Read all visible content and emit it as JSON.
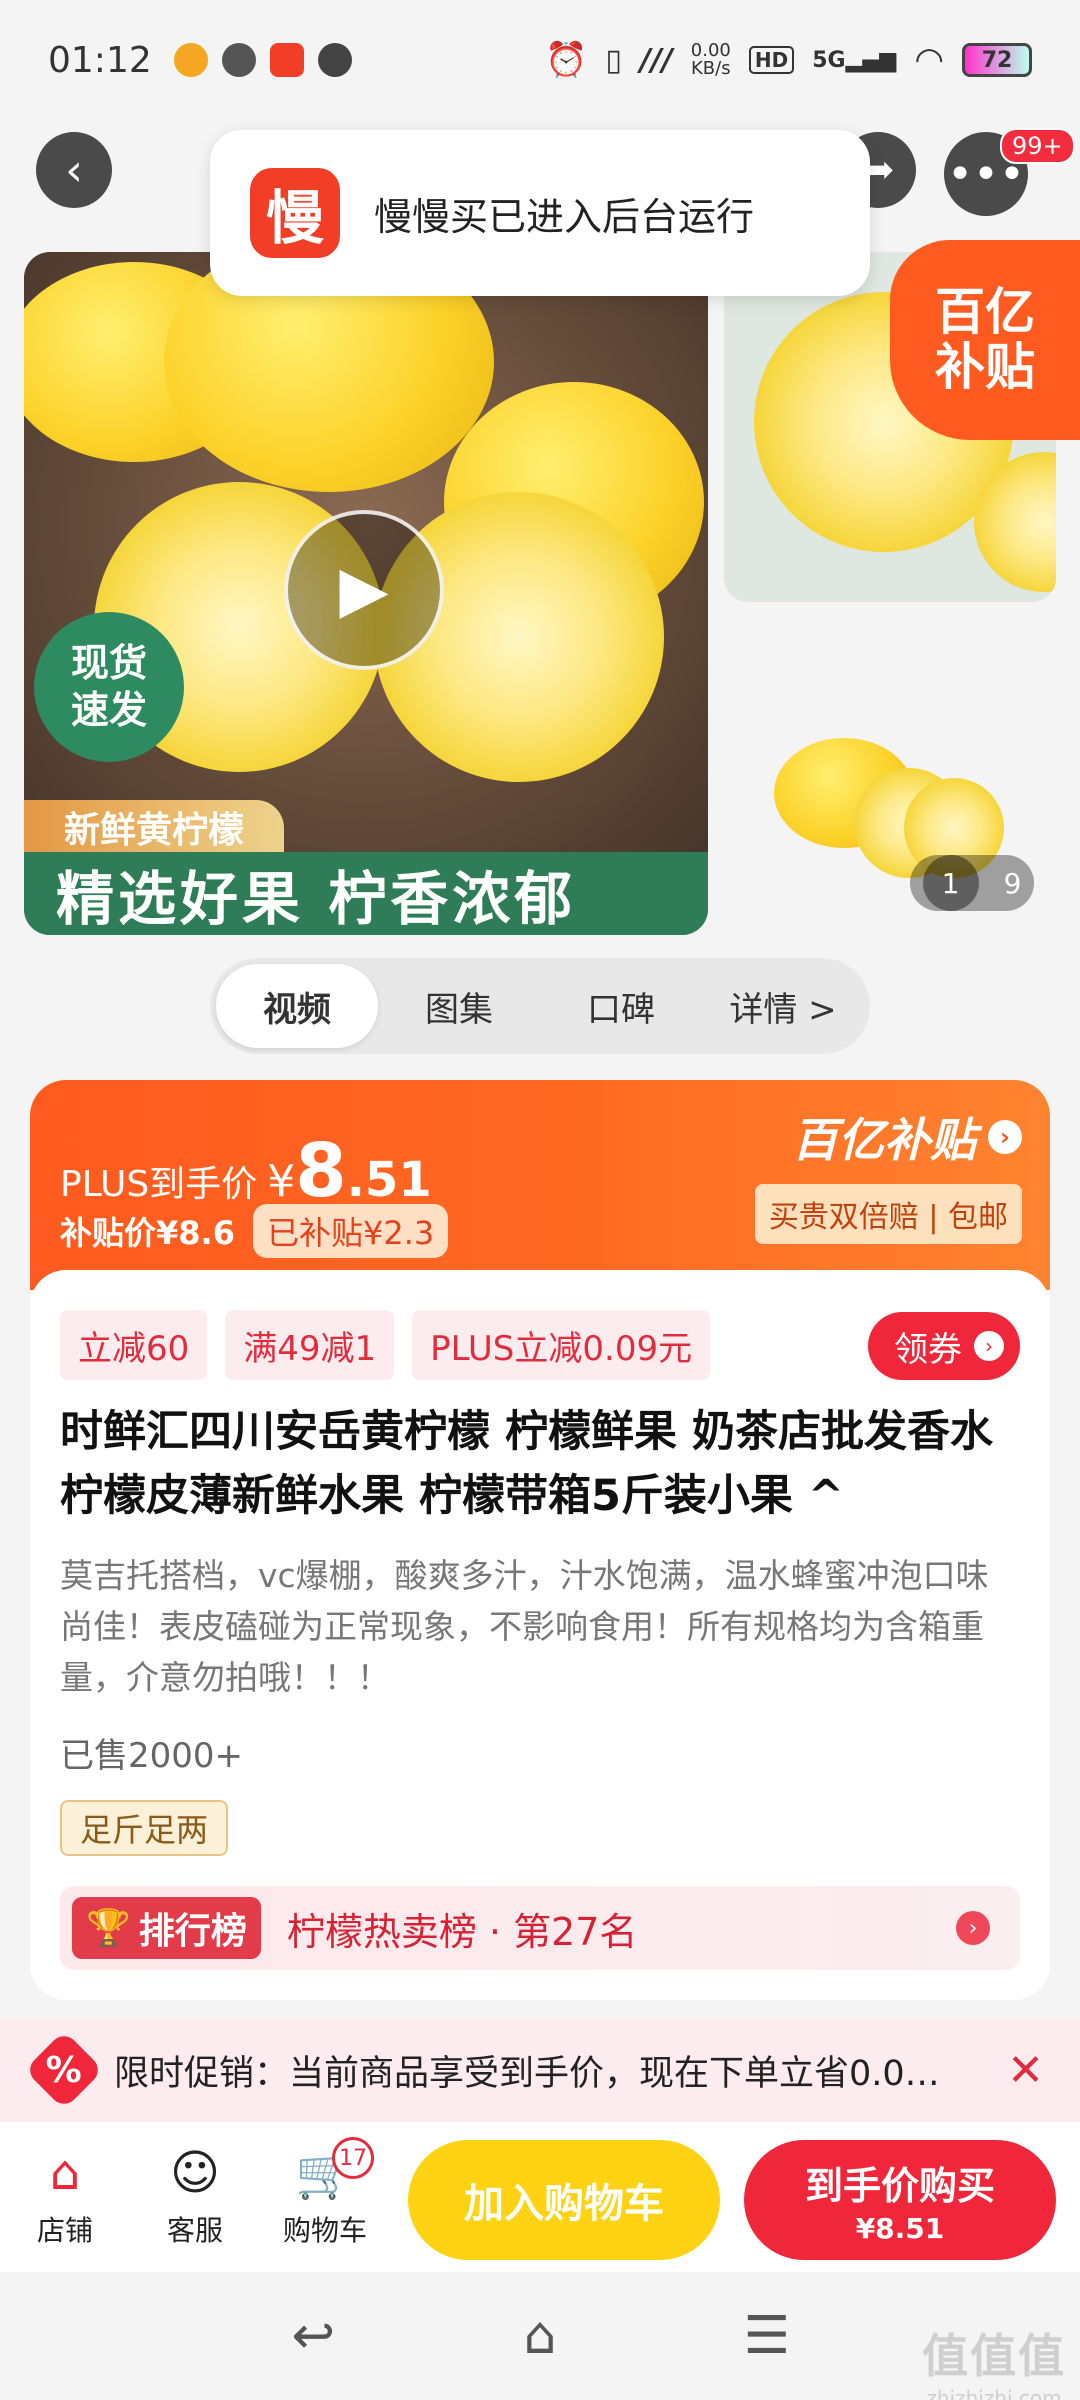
{
  "status": {
    "time": "01:12",
    "net_speed": "0.00\nKB/s",
    "net_speed_top": "0.00",
    "net_speed_unit": "KB/s",
    "network": "5G",
    "battery": "72"
  },
  "toast": {
    "logo_char": "慢",
    "text": "慢慢买已进入后台运行"
  },
  "header": {
    "more_badge": "99+"
  },
  "hero": {
    "spot_line1": "现货",
    "spot_line2": "速发",
    "fresh_tag": "新鲜黄柠檬",
    "slogan": "精选好果 柠香浓郁",
    "yi_line1": "百亿",
    "yi_line2": "补贴",
    "page_current": "1",
    "page_total": "9"
  },
  "tabs": [
    {
      "label": "视频",
      "active": true
    },
    {
      "label": "图集",
      "active": false
    },
    {
      "label": "口碑",
      "active": false
    },
    {
      "label": "详情 >",
      "active": false
    }
  ],
  "price": {
    "plus_label": "PLUS到手价",
    "yen": "¥",
    "int_part": "8",
    "dec_part": ".51",
    "subsidy_price": "补贴价¥8.6",
    "subsidized_tag": "已补贴¥2.3",
    "yi_title": "百亿补贴",
    "yi_sub": "买贵双倍赔 | 包邮"
  },
  "coupons": [
    "立减60",
    "满49减1",
    "PLUS立减0.09元"
  ],
  "get_coupon_label": "领券",
  "product": {
    "title": "时鲜汇四川安岳黄柠檬 柠檬鲜果 奶茶店批发香水柠檬皮薄新鲜水果 柠檬带箱5斤装小果 ^",
    "description": "莫吉托搭档，vc爆棚，酸爽多汁，汁水饱满，温水蜂蜜冲泡口味尚佳！表皮磕碰为正常现象，不影响食用！所有规格均为含箱重量，介意勿拍哦！！！",
    "sold": "已售2000+",
    "weight_tag": "足斤足两",
    "rank_badge": "排行榜",
    "rank_text": "柠檬热卖榜 · 第27名"
  },
  "promo": {
    "icon": "%",
    "text": "限时促销：当前商品享受到手价，现在下单立省0.0…"
  },
  "actions": {
    "shop": "店铺",
    "service": "客服",
    "cart": "购物车",
    "cart_count": "17",
    "add_cart": "加入购物车",
    "buy_line1": "到手价购买",
    "buy_line2": "¥8.51"
  },
  "watermark": {
    "line1": "值值值",
    "line2": "zhizhizhi.com"
  },
  "colors": {
    "accent_red": "#f0273b",
    "accent_orange": "#ff5a1f",
    "cart_yellow": "#ffd313",
    "lemon_green": "#2f7d58"
  }
}
